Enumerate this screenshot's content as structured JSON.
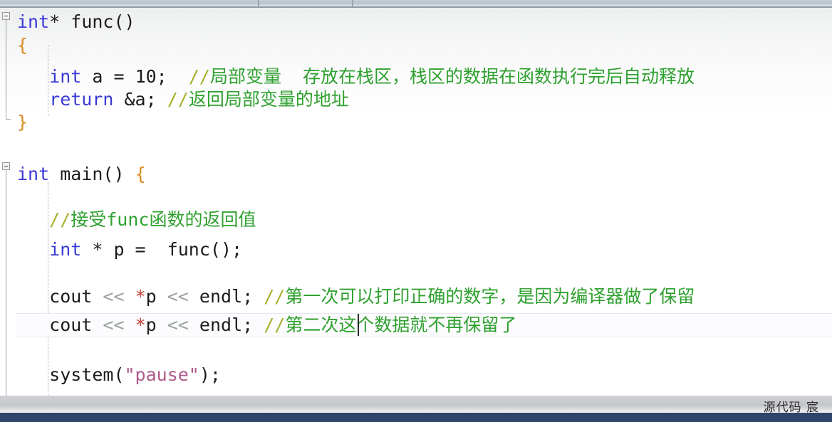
{
  "window": {
    "type": "code-editor",
    "language": "C++"
  },
  "top_chrome": {
    "tab_separator_positions": [
      362,
      494,
      1172
    ]
  },
  "editor": {
    "fold_markers": [
      {
        "label": "collapse",
        "glyph": "-",
        "line": 1
      },
      {
        "label": "collapse",
        "glyph": "-",
        "line": 7
      }
    ],
    "caret": {
      "visible": true,
      "line": 13,
      "after_text": "//第二次"
    },
    "current_line_number": 13,
    "lines": [
      {
        "n": 1,
        "indent": 0,
        "tokens": [
          {
            "t": "int",
            "c": "kw"
          },
          {
            "t": "*",
            "c": "plain"
          },
          {
            "t": " func",
            "c": "plain"
          },
          {
            "t": "()",
            "c": "paren"
          }
        ]
      },
      {
        "n": 2,
        "indent": 0,
        "tokens": [
          {
            "t": "{",
            "c": "brace"
          }
        ]
      },
      {
        "n": 3,
        "indent": 3,
        "tokens": [
          {
            "t": "int",
            "c": "kw"
          },
          {
            "t": " a = ",
            "c": "plain"
          },
          {
            "t": "10",
            "c": "num"
          },
          {
            "t": ";",
            "c": "plain"
          },
          {
            "t": "  ",
            "c": "plain"
          },
          {
            "t": "//",
            "c": "cmtslash"
          },
          {
            "t": "局部变量  存放在栈区，栈区的数据在函数执行完后自动释放",
            "c": "cmt"
          }
        ]
      },
      {
        "n": 4,
        "indent": 3,
        "tokens": [
          {
            "t": "return",
            "c": "kw"
          },
          {
            "t": " &a; ",
            "c": "plain"
          },
          {
            "t": "//",
            "c": "cmtslash"
          },
          {
            "t": "返回局部变量的地址",
            "c": "cmt"
          }
        ]
      },
      {
        "n": 5,
        "indent": 0,
        "tokens": [
          {
            "t": "}",
            "c": "brace"
          }
        ]
      },
      {
        "n": 6,
        "indent": 0,
        "tokens": []
      },
      {
        "n": 7,
        "indent": 0,
        "tokens": [
          {
            "t": "int",
            "c": "kw"
          },
          {
            "t": " main",
            "c": "plain"
          },
          {
            "t": "()",
            "c": "paren"
          },
          {
            "t": " ",
            "c": "plain"
          },
          {
            "t": "{",
            "c": "brace"
          }
        ]
      },
      {
        "n": 8,
        "indent": 0,
        "tokens": []
      },
      {
        "n": 9,
        "indent": 3,
        "tokens": [
          {
            "t": "//",
            "c": "cmtslash"
          },
          {
            "t": "接受func函数的返回值",
            "c": "cmt"
          }
        ]
      },
      {
        "n": 10,
        "indent": 3,
        "tokens": [
          {
            "t": "int",
            "c": "kw"
          },
          {
            "t": " * p =  func();",
            "c": "plain"
          }
        ]
      },
      {
        "n": 11,
        "indent": 0,
        "tokens": []
      },
      {
        "n": 12,
        "indent": 3,
        "tokens": [
          {
            "t": "cout ",
            "c": "plain"
          },
          {
            "t": "<<",
            "c": "shift"
          },
          {
            "t": " ",
            "c": "plain"
          },
          {
            "t": "*",
            "c": "star"
          },
          {
            "t": "p ",
            "c": "plain"
          },
          {
            "t": "<<",
            "c": "shift"
          },
          {
            "t": " endl; ",
            "c": "plain"
          },
          {
            "t": "//",
            "c": "cmtslash"
          },
          {
            "t": "第一次可以打印正确的数字，是因为编译器做了保留",
            "c": "cmt"
          }
        ]
      },
      {
        "n": 13,
        "indent": 3,
        "tokens": [
          {
            "t": "cout ",
            "c": "plain"
          },
          {
            "t": "<<",
            "c": "shift"
          },
          {
            "t": " ",
            "c": "plain"
          },
          {
            "t": "*",
            "c": "star"
          },
          {
            "t": "p ",
            "c": "plain"
          },
          {
            "t": "<<",
            "c": "shift"
          },
          {
            "t": " endl; ",
            "c": "plain"
          },
          {
            "t": "//",
            "c": "cmtslash"
          },
          {
            "t": "第二次这个数据就不再保留了",
            "c": "cmt"
          }
        ]
      },
      {
        "n": 14,
        "indent": 0,
        "tokens": []
      },
      {
        "n": 15,
        "indent": 3,
        "tokens": [
          {
            "t": "system(",
            "c": "plain"
          },
          {
            "t": "\"pause\"",
            "c": "str"
          },
          {
            "t": ");",
            "c": "plain"
          }
        ]
      }
    ]
  },
  "bottom": {
    "watermark": "源代码  宸"
  },
  "colors": {
    "keyword": "#3a3ad6",
    "comment": "#2fa12f",
    "comment_slash": "#a8b02a",
    "string": "#b05a8a",
    "brace": "#d98b22",
    "shift_operator": "#9aa39a",
    "star_operator": "#c23b2e",
    "status_bar": "#2e4468",
    "editor_background": "#ffffff"
  }
}
